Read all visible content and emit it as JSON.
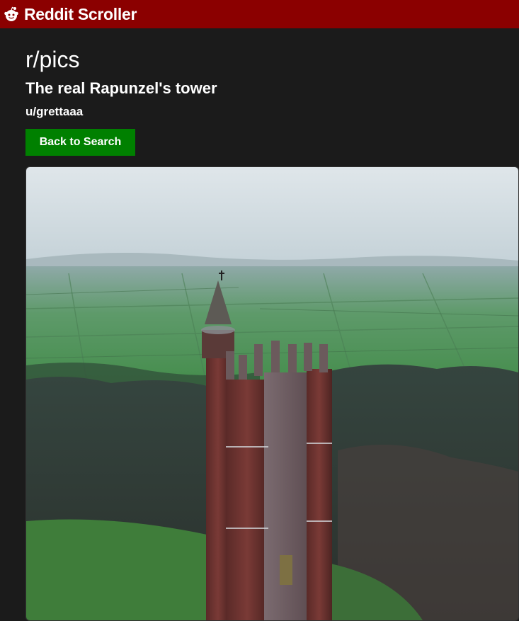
{
  "header": {
    "app_title": "Reddit Scroller",
    "logo_icon": "reddit-alien-icon",
    "background_color": "#8b0000"
  },
  "post": {
    "subreddit": "r/pics",
    "title": "The real Rapunzel's tower",
    "author": "u/grettaaa",
    "image_icon": "tower-photo"
  },
  "actions": {
    "back_label": "Back to Search",
    "back_color": "#008000"
  }
}
